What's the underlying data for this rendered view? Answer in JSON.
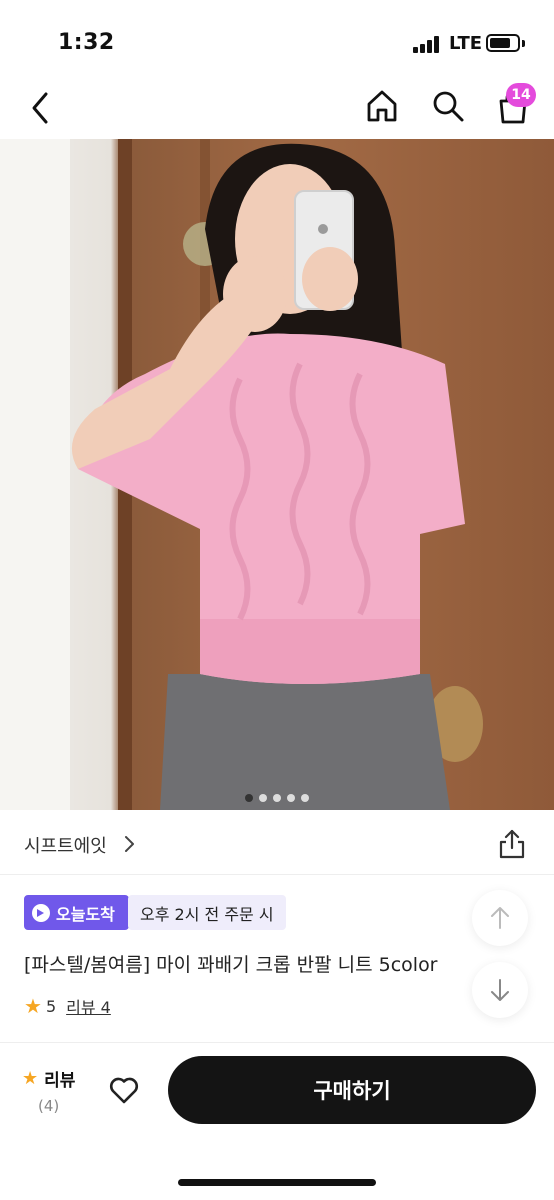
{
  "status_bar": {
    "time": "1:32",
    "network": "LTE",
    "battery_level": 0.75
  },
  "nav": {
    "cart_count": "14"
  },
  "gallery": {
    "page_count": 5,
    "current_page": 1
  },
  "brand": {
    "name": "시프트에잇"
  },
  "badges": {
    "today_delivery": "오늘도착",
    "order_cutoff": "오후 2시 전 주문 시"
  },
  "product": {
    "title": "[파스텔/봄여름] 마이 꽈배기 크롭 반팔 니트 5color"
  },
  "rating": {
    "star": "★",
    "score": "5",
    "review_link": "리뷰 4"
  },
  "bottom_bar": {
    "review_label": "리뷰",
    "review_count": "(4)",
    "buy_label": "구매하기"
  },
  "colors": {
    "accent_purple": "#7058ea",
    "badge_pink": "#e44bdc",
    "star": "#f6a623",
    "buy_button": "#141414"
  }
}
